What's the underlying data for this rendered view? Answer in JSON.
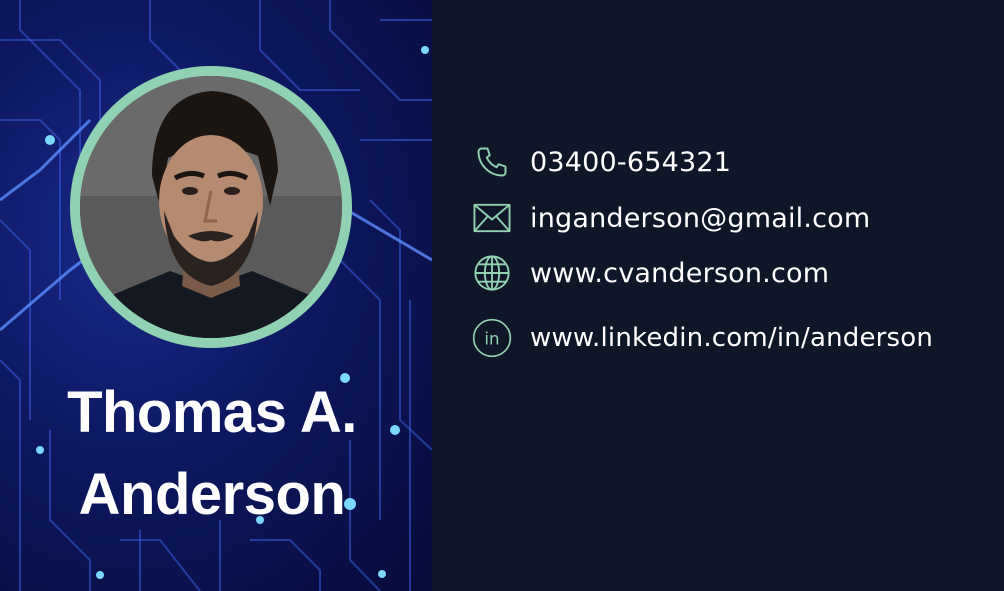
{
  "profile": {
    "name_line1": "Thomas A.",
    "name_line2": "Anderson"
  },
  "contacts": {
    "phone": "03400-654321",
    "email": "inganderson@gmail.com",
    "website": "www.cvanderson.com",
    "linkedin": "www.linkedin.com/in/anderson"
  },
  "icons": {
    "phone": "phone-icon",
    "email": "envelope-icon",
    "website": "globe-icon",
    "linkedin": "linkedin-icon"
  },
  "colors": {
    "background": "#0f1628",
    "accent": "#8fd1b2",
    "text": "#ffffff",
    "left_panel": "#0d1760"
  }
}
